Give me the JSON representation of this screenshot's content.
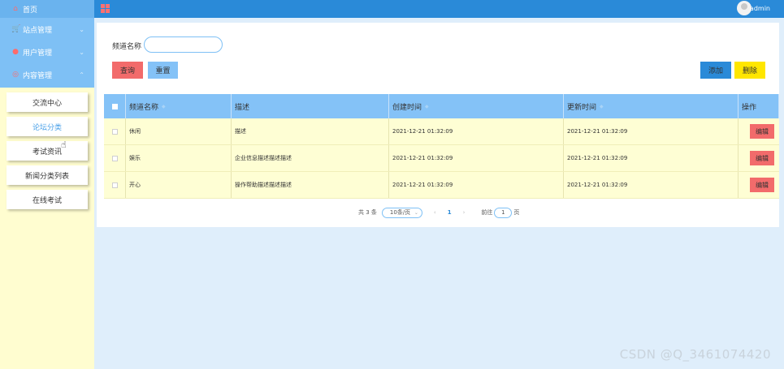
{
  "sidebar": {
    "home": "首页",
    "menus": [
      {
        "label": "站点管理",
        "icon": "cart-icon"
      },
      {
        "label": "用户管理",
        "icon": "user-icon"
      },
      {
        "label": "内容管理",
        "icon": "globe-icon"
      }
    ],
    "submenu": [
      "交流中心",
      "论坛分类",
      "考试资讯",
      "新闻分类列表",
      "在线考试"
    ],
    "active_submenu": "论坛分类"
  },
  "topbar": {
    "user": "admin"
  },
  "search": {
    "label": "频道名称",
    "value": ""
  },
  "buttons": {
    "query": "查询",
    "reset": "重置",
    "add": "添加",
    "delete": "删除"
  },
  "table": {
    "headers": [
      "频道名称",
      "描述",
      "创建时间",
      "更新时间",
      "操作"
    ],
    "rows": [
      {
        "name": "休闲",
        "desc": "描述",
        "created": "2021-12-21 01:32:09",
        "updated": "2021-12-21 01:32:09",
        "action": "编辑"
      },
      {
        "name": "娱乐",
        "desc": "企业信息描述描述描述",
        "created": "2021-12-21 01:32:09",
        "updated": "2021-12-21 01:32:09",
        "action": "编辑"
      },
      {
        "name": "开心",
        "desc": "操作帮助描述描述描述",
        "created": "2021-12-21 01:32:09",
        "updated": "2021-12-21 01:32:09",
        "action": "编辑"
      }
    ]
  },
  "pagination": {
    "total": "共 3 条",
    "page_size": "10条/页",
    "prev": "‹",
    "current": "1",
    "next": "›",
    "goto_label": "前往",
    "goto_value": "1",
    "goto_unit": "页"
  },
  "watermark": "CSDN @Q_3461074420",
  "colors": {
    "topbar": "#2a8ad8",
    "sidebar_top": "#7ec0f5",
    "sidebar_bg": "#fffdd0",
    "table_header": "#84c2f7",
    "row_bg": "#fefed4",
    "danger": "#f26b6b",
    "warning": "#ffe600"
  }
}
